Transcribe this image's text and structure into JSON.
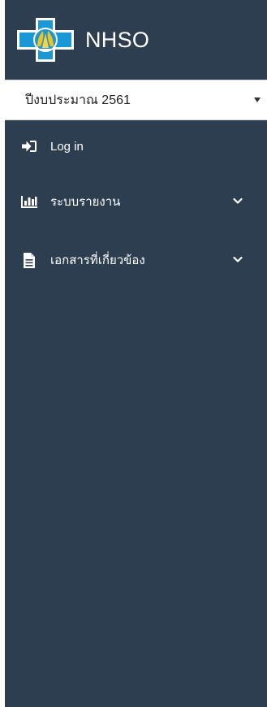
{
  "brand": {
    "name": "NHSO",
    "logo_icon": "nhso-cross-logo-icon",
    "logo_colors": {
      "frame": "#ffffff",
      "fill": "#1a97d6",
      "hands": "#f2c21a"
    }
  },
  "year_select": {
    "value": "ปีงบประมาณ 2561",
    "caret_icon": "caret-down-icon"
  },
  "menu": {
    "items": [
      {
        "label": "Log in",
        "icon": "sign-in-icon"
      },
      {
        "label": "ระบบรายงาน",
        "icon": "bar-chart-icon",
        "chevron": "chevron-down-icon"
      },
      {
        "label": "เอกสารที่เกี่ยวข้อง",
        "icon": "document-icon",
        "chevron": "chevron-down-icon"
      }
    ]
  },
  "colors": {
    "sidebar_bg": "#2c3e50",
    "text": "#ffffff",
    "select_bg": "#ffffff"
  }
}
